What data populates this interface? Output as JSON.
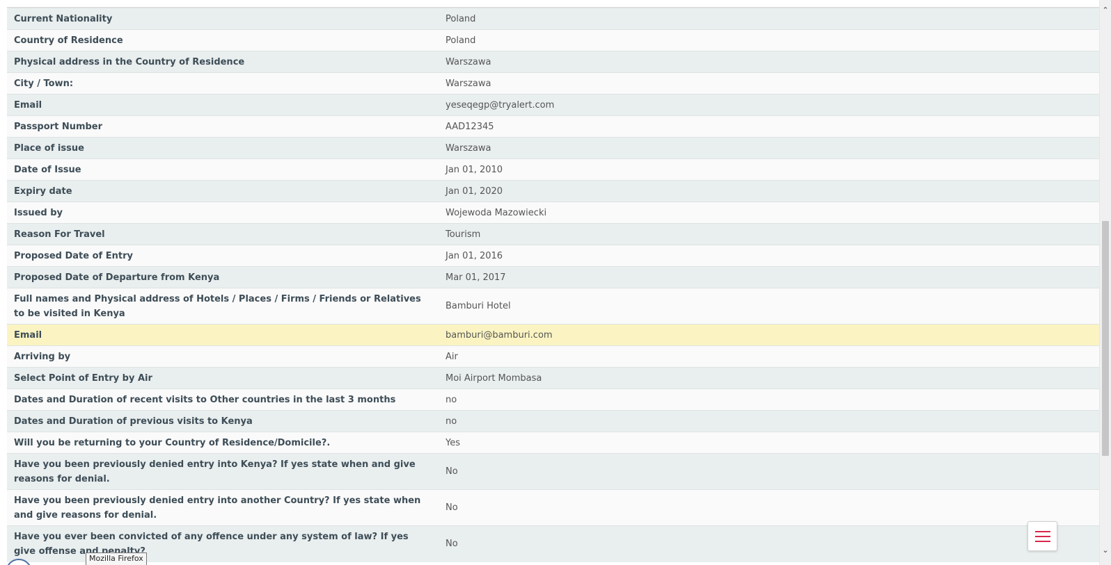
{
  "rows": [
    {
      "label": "Current Nationality",
      "value": "Poland"
    },
    {
      "label": "Country of Residence",
      "value": "Poland"
    },
    {
      "label": "Physical address in the Country of Residence",
      "value": "Warszawa"
    },
    {
      "label": "City / Town:",
      "value": "Warszawa"
    },
    {
      "label": "Email",
      "value": "yeseqegp@tryalert.com"
    },
    {
      "label": "Passport Number",
      "value": "AAD12345"
    },
    {
      "label": "Place of issue",
      "value": "Warszawa"
    },
    {
      "label": "Date of Issue",
      "value": "Jan 01, 2010"
    },
    {
      "label": "Expiry date",
      "value": "Jan 01, 2020"
    },
    {
      "label": "Issued by",
      "value": "Wojewoda Mazowiecki"
    },
    {
      "label": "Reason For Travel",
      "value": "Tourism"
    },
    {
      "label": "Proposed Date of Entry",
      "value": "Jan 01, 2016"
    },
    {
      "label": "Proposed Date of Departure from Kenya",
      "value": "Mar 01, 2017"
    },
    {
      "label": "Full names and Physical address of Hotels / Places / Firms / Friends or Relatives to be visited in Kenya",
      "value": "Bamburi Hotel"
    },
    {
      "label": "Email",
      "value": "bamburi@bamburi.com"
    },
    {
      "label": "Arriving by",
      "value": "Air"
    },
    {
      "label": "Select Point of Entry by Air",
      "value": "Moi Airport Mombasa"
    },
    {
      "label": "Dates and Duration of recent visits to Other countries in the last 3 months",
      "value": "no"
    },
    {
      "label": "Dates and Duration of previous visits to Kenya",
      "value": "no"
    },
    {
      "label": "Will you be returning to your Country of Residence/Domicile?.",
      "value": "Yes"
    },
    {
      "label": "Have you been previously denied entry into Kenya? If yes state when and give reasons for denial.",
      "value": "No"
    },
    {
      "label": "Have you been previously denied entry into another Country? If yes state when and give reasons for denial.",
      "value": "No"
    },
    {
      "label": "Have you ever been convicted of any offence under any system of law? If yes give offense and penalty?",
      "value": "No"
    }
  ],
  "tooltip": "Mozilla Firefox",
  "menu_icon": "hamburger-menu-icon",
  "colors": {
    "row_odd": "#e9eeee",
    "row_even": "#fafafa",
    "row_highlight": "#fbf4c2",
    "label_text": "#3d4d57",
    "menu_icon": "#d9254a"
  }
}
